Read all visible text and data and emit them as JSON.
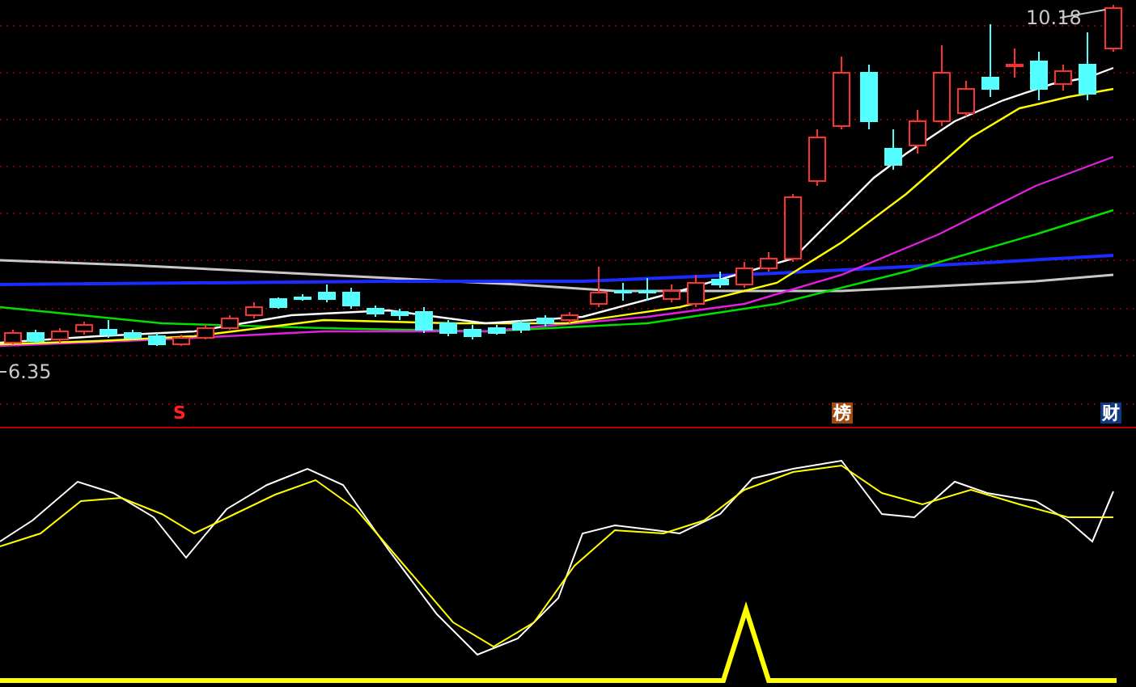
{
  "price_panel": {
    "high_label": "10.18",
    "low_label": "6.35"
  },
  "event_markers": [
    {
      "kind": "signal",
      "text": "S"
    },
    {
      "kind": "ranking",
      "text": "榜"
    },
    {
      "kind": "finance",
      "text": "财"
    }
  ]
}
